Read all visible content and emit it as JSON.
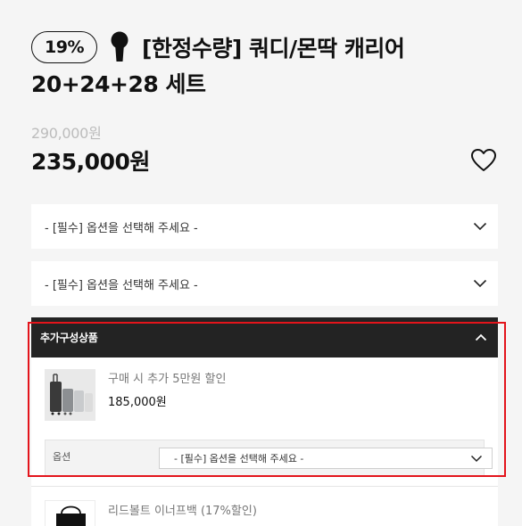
{
  "product": {
    "discount_badge": "19%",
    "title_line1": "[한정수량] 쿼디/몬딱 캐리어",
    "title_line2": "20+24+28 세트",
    "original_price": "290,000원",
    "sale_price": "235,000원"
  },
  "icons": {
    "keyhole": "keyhole-icon",
    "wishlist": "heart-icon",
    "chevron_down": "chevron-down-icon",
    "chevron_up": "chevron-up-icon"
  },
  "options": {
    "select1_placeholder": "- [필수] 옵션을 선택해 주세요 -",
    "select2_placeholder": "- [필수] 옵션을 선택해 주세요 -"
  },
  "addon": {
    "header_label": "추가구성상품",
    "items": [
      {
        "name": "구매 시 추가 5만원 할인",
        "price": "185,000원",
        "option_label": "옵션",
        "option_placeholder": "- [필수] 옵션을 선택해 주세요 -"
      },
      {
        "name": "리드볼트 이너프백 (17%할인)"
      }
    ]
  },
  "colors": {
    "accent_red": "#e3141b",
    "header_dark": "#232323",
    "background": "#f5f5f5"
  }
}
